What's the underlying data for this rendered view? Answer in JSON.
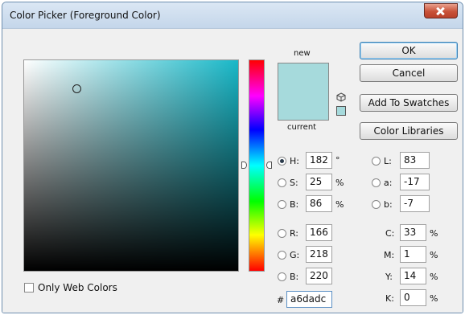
{
  "window": {
    "title": "Color Picker (Foreground Color)"
  },
  "preview": {
    "new_label": "new",
    "current_label": "current",
    "new_color": "#a6dadc",
    "current_color": "#a6dadc"
  },
  "buttons": {
    "ok": "OK",
    "cancel": "Cancel",
    "add": "Add To Swatches",
    "libraries": "Color Libraries"
  },
  "hsb": [
    {
      "key": "H:",
      "value": "182",
      "unit": "°"
    },
    {
      "key": "S:",
      "value": "25",
      "unit": "%"
    },
    {
      "key": "B:",
      "value": "86",
      "unit": "%"
    }
  ],
  "rgb": [
    {
      "key": "R:",
      "value": "166"
    },
    {
      "key": "G:",
      "value": "218"
    },
    {
      "key": "B:",
      "value": "220"
    }
  ],
  "lab": [
    {
      "key": "L:",
      "value": "83"
    },
    {
      "key": "a:",
      "value": "-17"
    },
    {
      "key": "b:",
      "value": "-7"
    }
  ],
  "cmyk": [
    {
      "key": "C:",
      "value": "33",
      "unit": "%"
    },
    {
      "key": "M:",
      "value": "1",
      "unit": "%"
    },
    {
      "key": "Y:",
      "value": "14",
      "unit": "%"
    },
    {
      "key": "K:",
      "value": "0",
      "unit": "%"
    }
  ],
  "hex": {
    "label": "#",
    "value": "a6dadc"
  },
  "options": {
    "web_only": "Only Web Colors"
  },
  "icons": {
    "close": "close-icon",
    "cube": "gamut-cube-icon"
  }
}
